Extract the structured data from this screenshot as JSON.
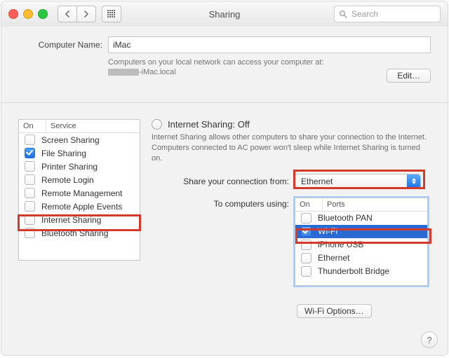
{
  "window": {
    "title": "Sharing",
    "search_placeholder": "Search"
  },
  "computer_name": {
    "label": "Computer Name:",
    "value": "iMac",
    "note_prefix": "Computers on your local network can access your computer at:",
    "hostname_suffix": "-iMac.local",
    "edit_label": "Edit…"
  },
  "services": {
    "col_on": "On",
    "col_service": "Service",
    "items": [
      {
        "label": "Screen Sharing",
        "checked": false
      },
      {
        "label": "File Sharing",
        "checked": true
      },
      {
        "label": "Printer Sharing",
        "checked": false
      },
      {
        "label": "Remote Login",
        "checked": false
      },
      {
        "label": "Remote Management",
        "checked": false
      },
      {
        "label": "Remote Apple Events",
        "checked": false
      },
      {
        "label": "Internet Sharing",
        "checked": false
      },
      {
        "label": "Bluetooth Sharing",
        "checked": false
      }
    ]
  },
  "internet_sharing": {
    "title": "Internet Sharing: Off",
    "description": "Internet Sharing allows other computers to share your connection to the Internet. Computers connected to AC power won't sleep while Internet Sharing is turned on.",
    "share_from_label": "Share your connection from:",
    "share_from_value": "Ethernet",
    "to_label": "To computers using:",
    "ports": {
      "col_on": "On",
      "col_ports": "Ports",
      "items": [
        {
          "label": "Bluetooth PAN",
          "checked": false,
          "selected": false
        },
        {
          "label": "Wi-Fi",
          "checked": true,
          "selected": true
        },
        {
          "label": "iPhone USB",
          "checked": false,
          "selected": false
        },
        {
          "label": "Ethernet",
          "checked": false,
          "selected": false
        },
        {
          "label": "Thunderbolt Bridge",
          "checked": false,
          "selected": false
        }
      ]
    },
    "wifi_options_label": "Wi-Fi Options…"
  },
  "help_label": "?"
}
